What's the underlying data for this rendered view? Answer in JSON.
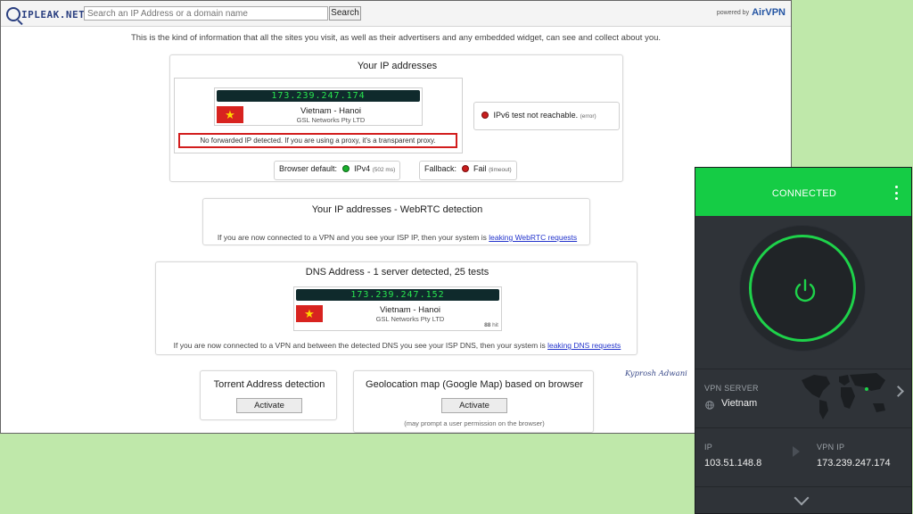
{
  "header": {
    "logo_text": "IPLEAK.NET",
    "search_placeholder": "Search an IP Address or a domain name",
    "search_button": "Search",
    "powered_by": "powered by",
    "brand": "AirVPN"
  },
  "intro_text": "This is the kind of information that all the sites you visit, as well as their advertisers and any embedded widget, can see and collect about you.",
  "ip_card": {
    "title": "Your IP addresses",
    "ip": "173.239.247.174",
    "location": "Vietnam - Hanoi",
    "isp": "GSL Networks Pty LTD",
    "notice": "No forwarded IP detected. If you are using a proxy, it's a transparent proxy.",
    "ipv6_text": "IPv6 test not reachable.",
    "ipv6_note": "(error)",
    "browser_default_label": "Browser default:",
    "browser_default_value": "IPv4",
    "browser_default_time": "(502 ms)",
    "fallback_label": "Fallback:",
    "fallback_value": "Fail",
    "fallback_note": "(timeout)"
  },
  "webrtc_card": {
    "title": "Your IP addresses - WebRTC detection",
    "text": "If you are now connected to a VPN and you see your ISP IP, then your system is",
    "link": "leaking WebRTC requests"
  },
  "dns_card": {
    "title": "DNS Address - 1 server detected, 25 tests",
    "ip": "173.239.247.152",
    "location": "Vietnam - Hanoi",
    "isp": "GSL Networks Pty LTD",
    "hits": "88",
    "hit_label": "hit",
    "text": "If you are now connected to a VPN and between the detected DNS you see your ISP DNS, then your system is",
    "link": "leaking DNS requests"
  },
  "torrent_card": {
    "title": "Torrent Address detection",
    "button": "Activate"
  },
  "geo_card": {
    "title": "Geolocation map (Google Map) based on browser",
    "button": "Activate",
    "note": "(may prompt a user permission on the browser)"
  },
  "signature": "Kyprosh Adwani",
  "vpn_app": {
    "status": "CONNECTED",
    "server_label": "VPN SERVER",
    "server_value": "Vietnam",
    "ip_label": "IP",
    "ip_value": "103.51.148.8",
    "vpn_ip_label": "VPN IP",
    "vpn_ip_value": "173.239.247.174",
    "accent": "#15cc45"
  }
}
